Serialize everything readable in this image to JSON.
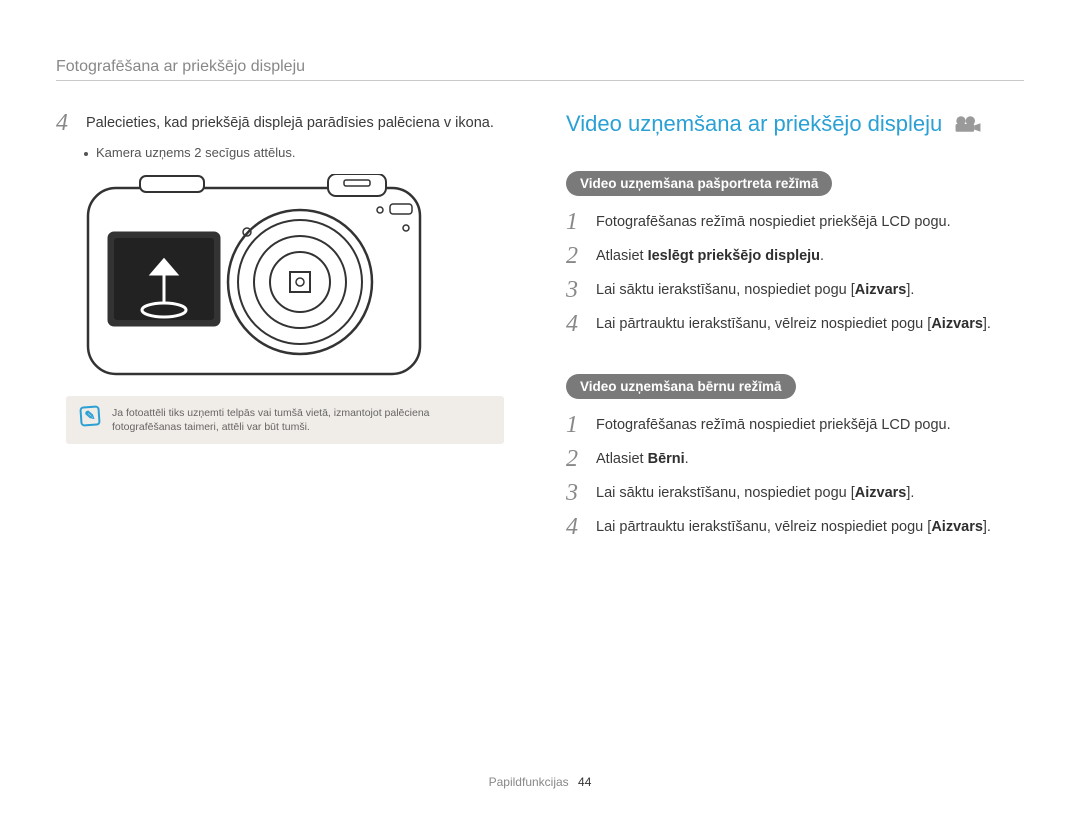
{
  "header": "Fotografēšana ar priekšējo displeju",
  "left": {
    "step4_num": "4",
    "step4_text_a": "Palecieties, kad priekšējā displejā parādīsies palēciena v ikona.",
    "bullet": "Kamera uzņems 2 secīgus attēlus.",
    "note": "Ja fotoattēli tiks uzņemti telpās vai tumšā vietā, izmantojot palēciena fotografēšanas taimeri, attēli var būt tumši."
  },
  "right": {
    "title": "Video uzņemšana ar priekšējo displeju",
    "section1": {
      "pill": "Video uzņemšana pašportreta režīmā",
      "steps": [
        {
          "n": "1",
          "t": "Fotografēšanas režīmā nospiediet priekšējā LCD pogu."
        },
        {
          "n": "2",
          "t_pre": "Atlasiet ",
          "t_bold": "Ieslēgt priekšējo displeju",
          "t_post": "."
        },
        {
          "n": "3",
          "t_pre": "Lai sāktu ierakstīšanu, nospiediet pogu [",
          "t_bold": "Aizvars",
          "t_post": "]."
        },
        {
          "n": "4",
          "t_pre": "Lai pārtrauktu ierakstīšanu, vēlreiz nospiediet pogu [",
          "t_bold": "Aizvars",
          "t_post": "]."
        }
      ]
    },
    "section2": {
      "pill": "Video uzņemšana bērnu režīmā",
      "steps": [
        {
          "n": "1",
          "t": "Fotografēšanas režīmā nospiediet priekšējā LCD pogu."
        },
        {
          "n": "2",
          "t_pre": "Atlasiet ",
          "t_bold": "Bērni",
          "t_post": "."
        },
        {
          "n": "3",
          "t_pre": "Lai sāktu ierakstīšanu, nospiediet pogu [",
          "t_bold": "Aizvars",
          "t_post": "]."
        },
        {
          "n": "4",
          "t_pre": "Lai pārtrauktu ierakstīšanu, vēlreiz nospiediet pogu [",
          "t_bold": "Aizvars",
          "t_post": "]."
        }
      ]
    }
  },
  "footer": {
    "label": "Papildfunkcijas",
    "page": "44"
  }
}
